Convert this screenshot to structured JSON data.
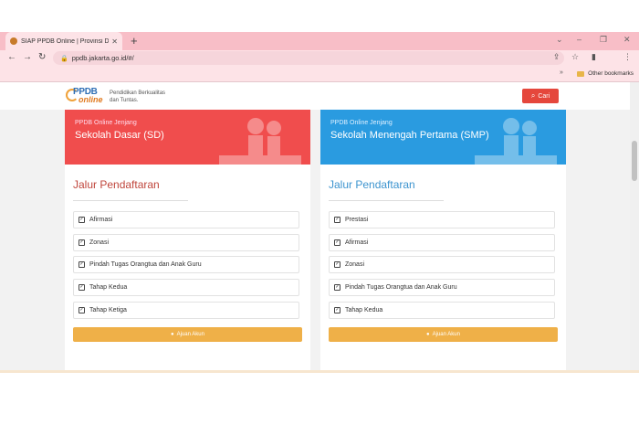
{
  "browser": {
    "tab_title": "SIAP PPDB Online | Provinsi DKI J",
    "tab_close": "✕",
    "new_tab": "+",
    "url": "ppdb.jakarta.go.id/#/",
    "bookmarks_label": "Other bookmarks",
    "bookmarks_chevron": "»"
  },
  "header": {
    "logo_top": "PPDB",
    "logo_bottom": "online",
    "tagline_line1": "Pendidikan Berkualitas",
    "tagline_line2": "dan Tuntas.",
    "search_label": "Cari"
  },
  "cards": [
    {
      "subtitle": "PPDB Online Jenjang",
      "title": "Sekolah Dasar (SD)",
      "heading": "Jalur Pendaftaran",
      "items": [
        "Afirmasi",
        "Zonasi",
        "Pindah Tugas Orangtua dan Anak Guru",
        "Tahap Kedua",
        "Tahap Ketiga"
      ],
      "button_label": "Ajuan Akun",
      "color": "#f04d4d"
    },
    {
      "subtitle": "PPDB Online Jenjang",
      "title": "Sekolah Menengah Pertama (SMP)",
      "heading": "Jalur Pendaftaran",
      "items": [
        "Prestasi",
        "Afirmasi",
        "Zonasi",
        "Pindah Tugas Orangtua dan Anak Guru",
        "Tahap Kedua"
      ],
      "button_label": "Ajuan Akun",
      "color": "#2a9be0"
    }
  ],
  "icons": {
    "check": "✓",
    "search": "🔍",
    "user_plus": "👤"
  }
}
